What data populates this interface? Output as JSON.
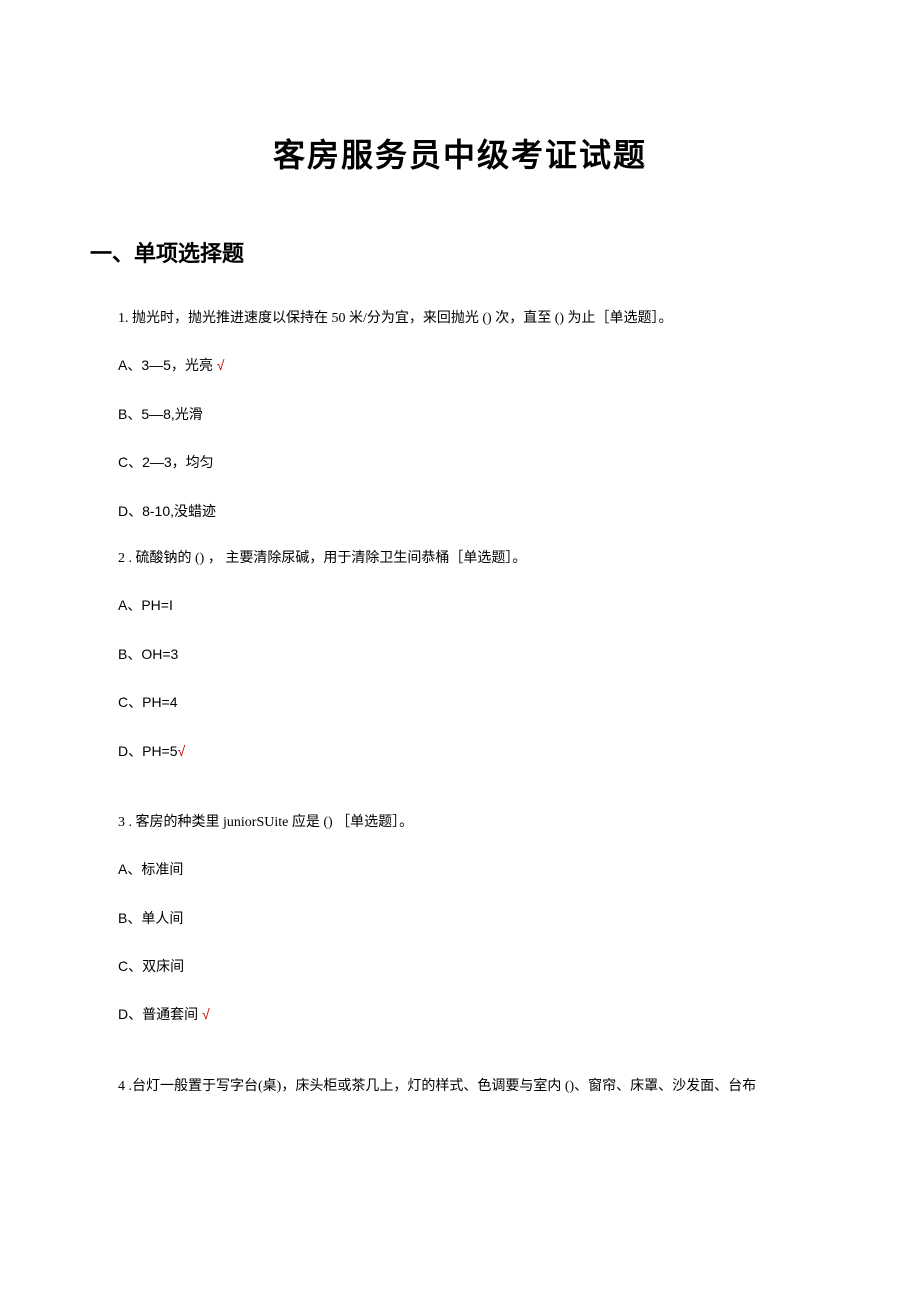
{
  "title": "客房服务员中级考证试题",
  "section_heading": "一、单项选择题",
  "questions": [
    {
      "text": "1. 抛光时，抛光推进速度以保持在 50 米/分为宜，来回抛光 () 次，直至 () 为止［单选题］。",
      "options": [
        {
          "label": "A、3—5，光亮",
          "correct": true
        },
        {
          "label": "B、5—8,光滑",
          "correct": false
        },
        {
          "label": "C、2—3，均匀",
          "correct": false
        },
        {
          "label": "D、8-10,没蜡迹",
          "correct": false
        }
      ],
      "gap_after": false
    },
    {
      "text": "2  . 硫酸钠的 () ， 主要清除尿碱，用于清除卫生间恭桶［单选题］。",
      "options": [
        {
          "label": "A、PH=I",
          "correct": false
        },
        {
          "label": "B、OH=3",
          "correct": false
        },
        {
          "label": "C、PH=4",
          "correct": false
        },
        {
          "label": "D、PH=5",
          "correct": true,
          "check_no_space": true
        }
      ],
      "gap_after": true
    },
    {
      "text": "3  . 客房的种类里 juniorSUite 应是 () ［单选题］。",
      "options": [
        {
          "label": "A、标准间",
          "correct": false
        },
        {
          "label": "B、单人间",
          "correct": false
        },
        {
          "label": "C、双床间",
          "correct": false
        },
        {
          "label": "D、普通套间",
          "correct": true
        }
      ],
      "gap_after": true
    },
    {
      "text": "4  .台灯一般置于写字台(桌)，床头柜或茶几上，灯的样式、色调要与室内 ()、窗帘、床罩、沙发面、台布",
      "options": [],
      "gap_after": false
    }
  ],
  "check_mark": "√"
}
